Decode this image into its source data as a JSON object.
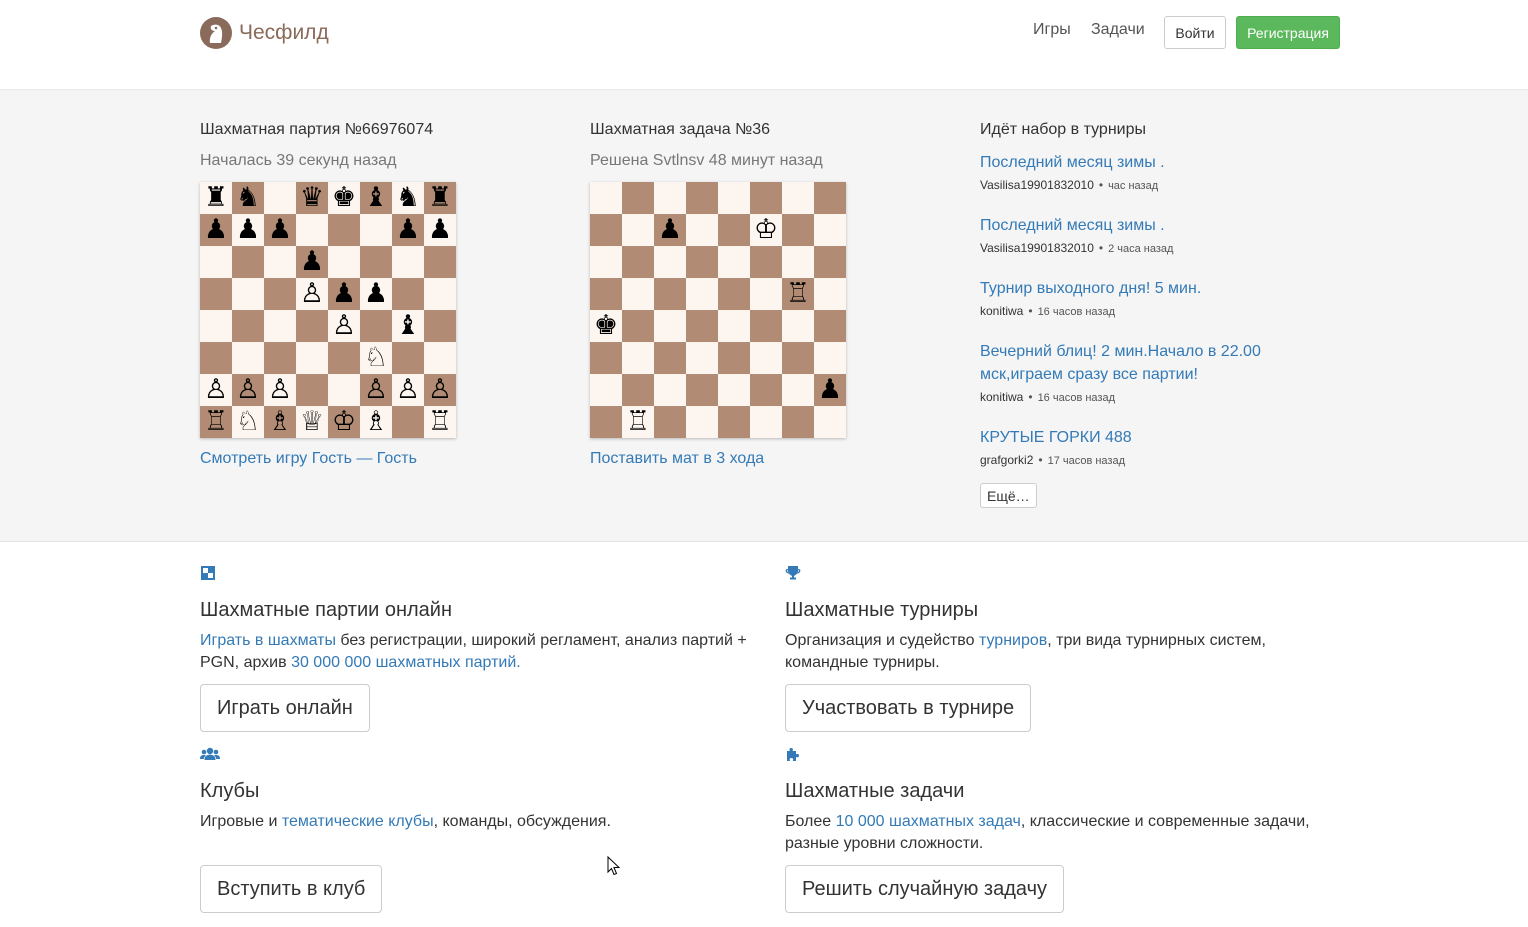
{
  "header": {
    "brand": "Чесфилд",
    "nav": [
      "Игры",
      "Задачи"
    ],
    "login_label": "Войти",
    "register_label": "Регистрация",
    "brand_color": "#8a6a5b",
    "register_color": "#5cb85c"
  },
  "game": {
    "title": "Шахматная партия №66976074",
    "subtitle": "Началась 39 секунд назад",
    "link": "Смотреть игру Гость — Гость",
    "board": [
      [
        "♜",
        "♞",
        "",
        "♛",
        "♚",
        "♝",
        "♞",
        "♜"
      ],
      [
        "♟",
        "♟",
        "♟",
        "",
        "",
        "",
        "♟",
        "♟"
      ],
      [
        "",
        "",
        "",
        "♟",
        "",
        "",
        "",
        ""
      ],
      [
        "",
        "",
        "",
        "♙",
        "♟",
        "♟",
        "",
        ""
      ],
      [
        "",
        "",
        "",
        "",
        "♙",
        "",
        "♝",
        ""
      ],
      [
        "",
        "",
        "",
        "",
        "",
        "♘",
        "",
        ""
      ],
      [
        "♙",
        "♙",
        "♙",
        "",
        "",
        "♙",
        "♙",
        "♙"
      ],
      [
        "♖",
        "♘",
        "♗",
        "♕",
        "♔",
        "♗",
        "",
        "♖"
      ]
    ]
  },
  "problem": {
    "title": "Шахматная задача №36",
    "subtitle": "Решена Svtlnsv 48 минут назад",
    "link": "Поставить мат в 3 хода",
    "board": [
      [
        "",
        "",
        "",
        "",
        "",
        "",
        "",
        ""
      ],
      [
        "",
        "",
        "♟",
        "",
        "",
        "♔",
        "",
        ""
      ],
      [
        "",
        "",
        "",
        "",
        "",
        "",
        "",
        ""
      ],
      [
        "",
        "",
        "",
        "",
        "",
        "",
        "♖",
        ""
      ],
      [
        "♚",
        "",
        "",
        "",
        "",
        "",
        "",
        ""
      ],
      [
        "",
        "",
        "",
        "",
        "",
        "",
        "",
        ""
      ],
      [
        "",
        "",
        "",
        "",
        "",
        "",
        "",
        "♟"
      ],
      [
        "",
        "♖",
        "",
        "",
        "",
        "",
        "",
        ""
      ]
    ]
  },
  "tournaments": {
    "heading": "Идёт набор в турниры",
    "items": [
      {
        "title": "Последний месяц зимы .",
        "author": "Vasilisa19901832010",
        "ago": "час назад"
      },
      {
        "title": "Последний месяц зимы .",
        "author": "Vasilisa19901832010",
        "ago": "2 часа назад"
      },
      {
        "title": "Турнир выходного дня! 5 мин.",
        "author": "konitiwa",
        "ago": "16 часов назад"
      },
      {
        "title": "Вечерний блиц! 2 мин.Начало в 22.00 мск,играем сразу все партии!",
        "author": "konitiwa",
        "ago": "16 часов назад"
      },
      {
        "title": "КРУТЫЕ ГОРКИ 488",
        "author": "grafgorki2",
        "ago": "17 часов назад"
      }
    ],
    "more_label": "Ещё…"
  },
  "features": {
    "online": {
      "icon": "board-icon",
      "title": "Шахматные партии онлайн",
      "link1": "Играть в шахматы",
      "text1": " без регистрации, широкий регламент, анализ партий + PGN, архив ",
      "link2": "30 000 000 шахматных партий.",
      "button": "Играть онлайн"
    },
    "tournaments": {
      "icon": "trophy-icon",
      "title": "Шахматные турниры",
      "text1": "Организация и судейство ",
      "link1": "турниров",
      "text2": ", три вида турнирных систем, командные турниры.",
      "button": "Участвовать в турнире"
    },
    "clubs": {
      "icon": "users-icon",
      "title": "Клубы",
      "text1": "Игровые и ",
      "link1": "тематические клубы",
      "text2": ", команды, обсуждения.",
      "button": "Вступить в клуб"
    },
    "problems": {
      "icon": "puzzle-icon",
      "title": "Шахматные задачи",
      "text1": "Более ",
      "link1": "10 000 шахматных задач",
      "text2": ", классические и современные задачи, разные уровни сложности.",
      "button": "Решить случайную задачу"
    }
  }
}
